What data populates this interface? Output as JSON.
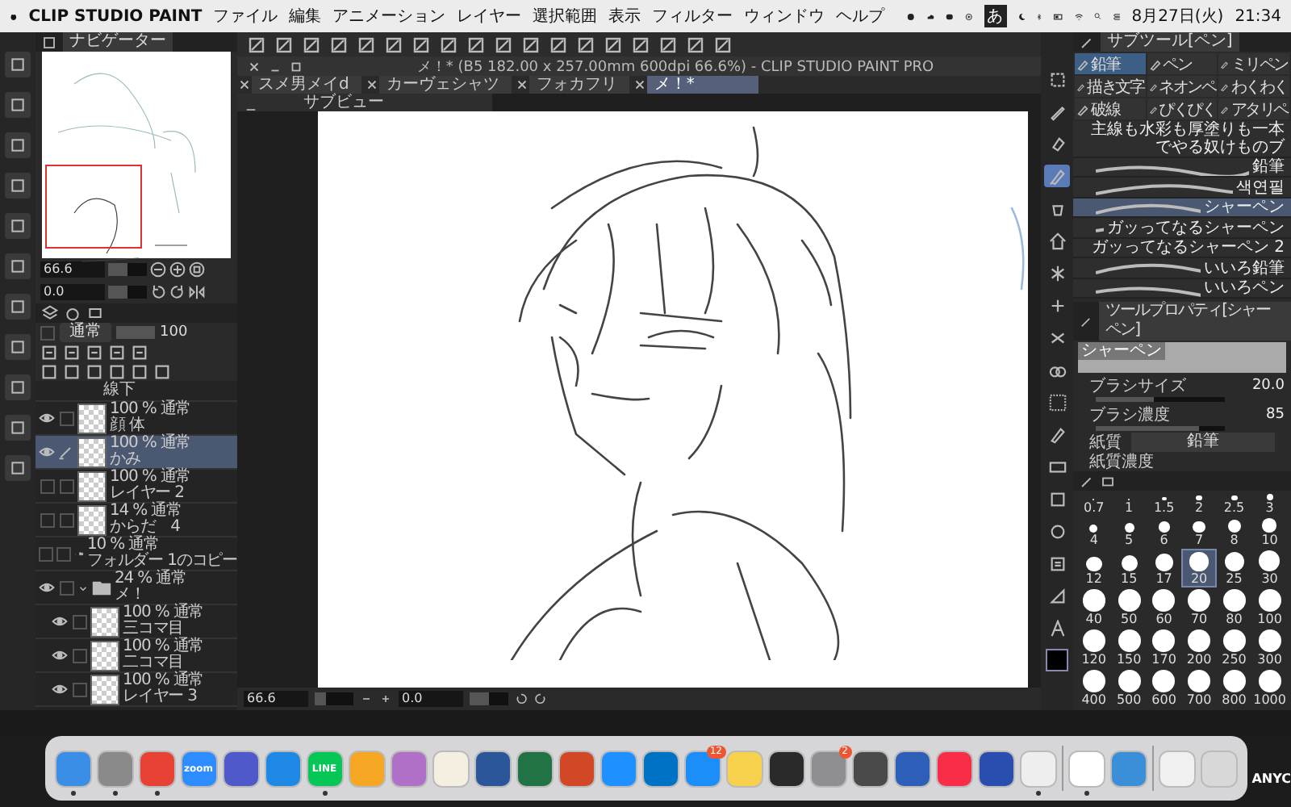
{
  "menu_bar": {
    "app_name": "CLIP STUDIO PAINT",
    "menus": [
      "ファイル",
      "編集",
      "アニメーション",
      "レイヤー",
      "選択範囲",
      "表示",
      "フィルター",
      "ウィンドウ",
      "ヘルプ"
    ],
    "ime": "あ",
    "date": "8月27日(火)",
    "time": "21:34"
  },
  "document": {
    "title": "メ！* (B5 182.00 x 257.00mm 600dpi 66.6%)  - CLIP STUDIO PAINT PRO",
    "tabs": [
      {
        "label": "スメ男メイd",
        "selected": false
      },
      {
        "label": "カーヴェシャツ",
        "selected": false
      },
      {
        "label": "フォカフリ",
        "selected": false
      },
      {
        "label": "メ！*",
        "selected": true
      }
    ],
    "sub_view": {
      "minimized": "_",
      "label": "サブビュー"
    }
  },
  "navigator": {
    "tab": "ナビゲーター",
    "zoom": {
      "value": "66.6",
      "level": 0.5
    },
    "angle": {
      "value": "0.0",
      "level": 0.5
    }
  },
  "layer_panel": {
    "blend_mode": "通常",
    "opacity": {
      "value": "100",
      "level": 1
    },
    "top_partial": "線下",
    "layers": [
      {
        "kind": "layer",
        "mode": "100 % 通常",
        "name": "顔 体",
        "visible": true,
        "selected": false,
        "editing": false
      },
      {
        "kind": "layer",
        "mode": "100 % 通常",
        "name": "かみ",
        "visible": true,
        "selected": true,
        "editing": true
      },
      {
        "kind": "layer",
        "mode": "100 % 通常",
        "name": "レイヤー 2",
        "visible": false,
        "selected": false,
        "editing": false
      },
      {
        "kind": "layer",
        "mode": "14 % 通常",
        "name": "からだ　4",
        "visible": false,
        "selected": false,
        "editing": false
      },
      {
        "kind": "folder",
        "mode": "10 % 通常",
        "name": "フォルダー 1のコピー",
        "visible": false,
        "selected": false,
        "editing": false,
        "expanded": false
      },
      {
        "kind": "folder",
        "mode": "24 % 通常",
        "name": "メ！",
        "visible": true,
        "selected": false,
        "editing": false,
        "expanded": true,
        "children": [
          {
            "kind": "layer",
            "mode": "100 % 通常",
            "name": "三コマ目",
            "visible": true,
            "selected": false,
            "editing": false
          },
          {
            "kind": "layer",
            "mode": "100 % 通常",
            "name": "二コマ目",
            "visible": true,
            "selected": false,
            "editing": false
          },
          {
            "kind": "layer",
            "mode": "100 % 通常",
            "name": "レイヤー 3",
            "visible": true,
            "selected": false,
            "editing": false
          }
        ]
      }
    ]
  },
  "sub_tool": {
    "tab": "サブツール[ペン]",
    "groups": [
      {
        "label": "鉛筆",
        "selected": true
      },
      {
        "label": "ペン",
        "selected": false
      },
      {
        "label": "ミリペン",
        "selected": false
      },
      {
        "label": "描き文字",
        "selected": false
      },
      {
        "label": "ネオンペ",
        "selected": false
      },
      {
        "label": "わくわく",
        "selected": false
      },
      {
        "label": "破線",
        "selected": false
      },
      {
        "label": "ぴくぴく",
        "selected": false
      },
      {
        "label": "アタリペ",
        "selected": false
      }
    ],
    "brushes": [
      {
        "label": "主線も水彩も厚塗りも一本でやる奴けものブ",
        "selected": false
      },
      {
        "label": "鉛筆",
        "selected": false
      },
      {
        "label": "색연필",
        "selected": false
      },
      {
        "label": "シャーペン",
        "selected": true
      },
      {
        "label": "ガッってなるシャーペン",
        "selected": false
      },
      {
        "label": "ガッってなるシャーペン 2",
        "selected": false
      },
      {
        "label": "いいろ鉛筆",
        "selected": false
      },
      {
        "label": "いいろペン",
        "selected": false
      }
    ]
  },
  "tool_property": {
    "tab": "ツールプロパティ[シャーペン]",
    "preview_label": "シャーペン",
    "brush_size": {
      "label": "ブラシサイズ",
      "value": "20.0",
      "level": 0.45
    },
    "brush_density": {
      "label": "ブラシ濃度",
      "value": "85",
      "level": 0.8
    },
    "paper": {
      "label": "紙質",
      "value": "鉛筆"
    },
    "paper_density": {
      "label": "紙質濃度"
    }
  },
  "brush_sizes": [
    {
      "label": "0.7",
      "selected": false
    },
    {
      "label": "1",
      "selected": false
    },
    {
      "label": "1.5",
      "selected": false
    },
    {
      "label": "2",
      "selected": false
    },
    {
      "label": "2.5",
      "selected": false
    },
    {
      "label": "3",
      "selected": false
    },
    {
      "label": "4",
      "selected": false
    },
    {
      "label": "5",
      "selected": false
    },
    {
      "label": "6",
      "selected": false
    },
    {
      "label": "7",
      "selected": false
    },
    {
      "label": "8",
      "selected": false
    },
    {
      "label": "10",
      "selected": false
    },
    {
      "label": "12",
      "selected": false
    },
    {
      "label": "15",
      "selected": false
    },
    {
      "label": "17",
      "selected": false
    },
    {
      "label": "20",
      "selected": true
    },
    {
      "label": "25",
      "selected": false
    },
    {
      "label": "30",
      "selected": false
    },
    {
      "label": "40",
      "selected": false
    },
    {
      "label": "50",
      "selected": false
    },
    {
      "label": "60",
      "selected": false
    },
    {
      "label": "70",
      "selected": false
    },
    {
      "label": "80",
      "selected": false
    },
    {
      "label": "100",
      "selected": false
    },
    {
      "label": "120",
      "selected": false
    },
    {
      "label": "150",
      "selected": false
    },
    {
      "label": "170",
      "selected": false
    },
    {
      "label": "200",
      "selected": false
    },
    {
      "label": "250",
      "selected": false
    },
    {
      "label": "300",
      "selected": false
    },
    {
      "label": "400",
      "selected": false
    },
    {
      "label": "500",
      "selected": false
    },
    {
      "label": "600",
      "selected": false
    },
    {
      "label": "700",
      "selected": false
    },
    {
      "label": "800",
      "selected": false
    },
    {
      "label": "1000",
      "selected": false
    }
  ],
  "tools": [
    {
      "selected": false
    },
    {
      "selected": false
    },
    {
      "selected": false
    },
    {
      "selected": true
    },
    {
      "selected": false
    },
    {
      "selected": false
    },
    {
      "selected": false
    },
    {
      "selected": false
    },
    {
      "selected": false
    },
    {
      "selected": false
    },
    {
      "selected": false
    },
    {
      "selected": false
    },
    {
      "selected": false
    },
    {
      "selected": false
    },
    {
      "selected": false
    },
    {
      "selected": false
    },
    {
      "selected": false
    },
    {
      "selected": false
    }
  ],
  "status": {
    "zoom": {
      "value": "66.6",
      "level": 0.3
    },
    "angle": {
      "value": "0.0",
      "level": 0.5
    }
  },
  "dock": [
    {
      "kind": "app",
      "color": "#3a8ee6",
      "running": true
    },
    {
      "kind": "app",
      "color": "#8a8a8a",
      "running": true
    },
    {
      "kind": "app",
      "color": "#e84235",
      "running": true
    },
    {
      "kind": "app",
      "color": "#2d8cff",
      "label": "zoom",
      "running": false
    },
    {
      "kind": "app",
      "color": "#5059c9",
      "running": false
    },
    {
      "kind": "app",
      "color": "#1e88e5",
      "running": false
    },
    {
      "kind": "app",
      "color": "#06c755",
      "label": "LINE",
      "running": true
    },
    {
      "kind": "app",
      "color": "#f5a623",
      "running": false
    },
    {
      "kind": "app",
      "color": "#b070c8",
      "running": false
    },
    {
      "kind": "app",
      "color": "#f4efe0",
      "running": false
    },
    {
      "kind": "app",
      "color": "#2b579a",
      "running": false
    },
    {
      "kind": "app",
      "color": "#217346",
      "running": false
    },
    {
      "kind": "app",
      "color": "#d24726",
      "running": false
    },
    {
      "kind": "app",
      "color": "#1e90ff",
      "running": false
    },
    {
      "kind": "app",
      "color": "#0072c6",
      "running": false
    },
    {
      "kind": "app",
      "color": "#1c8ef9",
      "badge": "12",
      "running": false
    },
    {
      "kind": "app",
      "color": "#f7d14b",
      "running": false
    },
    {
      "kind": "app",
      "color": "#2a2a2a",
      "running": false
    },
    {
      "kind": "app",
      "color": "#8e8e93",
      "badge": "2",
      "running": false
    },
    {
      "kind": "app",
      "color": "#4a4a4a",
      "running": false
    },
    {
      "kind": "app",
      "color": "#2d5fb8",
      "running": false
    },
    {
      "kind": "app",
      "color": "#fa2d48",
      "running": false
    },
    {
      "kind": "app",
      "color": "#2a4db0",
      "running": false
    },
    {
      "kind": "app",
      "color": "#eeeeee",
      "running": true
    },
    {
      "kind": "separator"
    },
    {
      "kind": "app",
      "color": "#ffffff",
      "running": true
    },
    {
      "kind": "app",
      "color": "#3a8fd8",
      "running": false
    },
    {
      "kind": "separator"
    },
    {
      "kind": "app",
      "color": "#f0f0f0",
      "running": false
    },
    {
      "kind": "app",
      "color": "#d8d8d8",
      "running": false
    }
  ],
  "desktop_text": "ANYC"
}
